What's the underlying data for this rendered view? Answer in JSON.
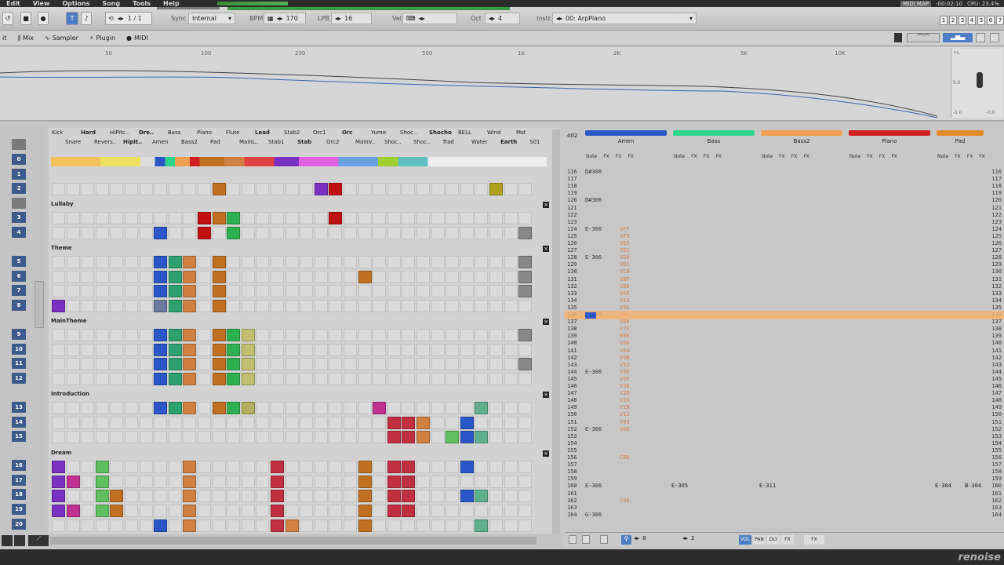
{
  "menu": {
    "items": [
      "Edit",
      "View",
      "Options",
      "Song",
      "Tools",
      "Help"
    ],
    "midi_map": "MIDI MAP",
    "time": "-00:02:10",
    "cpu": "CPU: 23.4%"
  },
  "toolbar": {
    "pos": "1 / 1",
    "sync_label": "Sync",
    "sync_value": "Internal",
    "bpm_label": "BPM",
    "bpm_value": "170",
    "lpb_label": "LPB",
    "lpb_value": "16",
    "vel_label": "Vel",
    "oct_label": "Oct",
    "oct_value": "4",
    "instr_label": "Instr.",
    "instr_value": "00: ArpPiano",
    "tracks": [
      "1",
      "2",
      "3",
      "4",
      "5",
      "6",
      "7"
    ]
  },
  "toolbar2": {
    "mix": "Mix",
    "sampler": "Sampler",
    "plugin": "Plugin",
    "midi": "MIDI"
  },
  "spectrum": {
    "freqs": [
      "50",
      "100",
      "200",
      "500",
      "1K",
      "2K",
      "5K",
      "10K"
    ],
    "db_top": "+L",
    "db_mid": "0.0",
    "db_bot": "-1.0",
    "db_bot2": "-0.0"
  },
  "matrix": {
    "tracks_top": [
      "Kick",
      "Hard",
      "HiPitc..",
      "Dre..",
      "Bass",
      "Piano",
      "Flute",
      "Lead",
      "Stab2",
      "Orc1",
      "Orc",
      "Yume",
      "Shoc..",
      "Shocho",
      "BELL",
      "Wind",
      "Mst"
    ],
    "tracks_bot": [
      "Snare",
      "Revers..",
      "Hipit..",
      "Amen",
      "Bass2",
      "Pad",
      "MainL..",
      "Stab1",
      "Stab",
      "Orc2",
      "MainV..",
      "Shoc..",
      "Shoc..",
      "Trad",
      "Water",
      "Earth",
      "S01"
    ],
    "sections": [
      "Lullaby",
      "Theme",
      "MainTheme",
      "Introduction",
      "Dream"
    ],
    "rows": [
      "0",
      "1",
      "2",
      "3",
      "4",
      "5",
      "6",
      "7",
      "8",
      "9",
      "10",
      "11",
      "12",
      "13",
      "14",
      "15",
      "16",
      "17",
      "18",
      "19",
      "20"
    ],
    "play_label": "PLAY"
  },
  "pattern": {
    "top_num": "402",
    "columns": [
      {
        "name": "Amen",
        "color": "#2b56c7"
      },
      {
        "name": "Bass",
        "color": "#2fd58f"
      },
      {
        "name": "Bass2",
        "color": "#f0a050"
      },
      {
        "name": "Piano",
        "color": "#d02020"
      },
      {
        "name": "Pad",
        "color": "#e08a2a"
      }
    ],
    "col_sub": [
      "Note",
      "FX",
      "FX",
      "FX"
    ],
    "lines": [
      {
        "n": "116",
        "note": "D#306",
        "fx": ""
      },
      {
        "n": "117",
        "note": "",
        "fx": ""
      },
      {
        "n": "118",
        "note": "",
        "fx": ""
      },
      {
        "n": "119",
        "note": "",
        "fx": ""
      },
      {
        "n": "120",
        "note": "D#306",
        "fx": ""
      },
      {
        "n": "121",
        "note": "",
        "fx": ""
      },
      {
        "n": "122",
        "note": "",
        "fx": ""
      },
      {
        "n": "123",
        "note": "",
        "fx": ""
      },
      {
        "n": "124",
        "note": "E-306",
        "fx": "VFF"
      },
      {
        "n": "125",
        "note": "",
        "fx": "VF5"
      },
      {
        "n": "126",
        "note": "",
        "fx": "VE5"
      },
      {
        "n": "127",
        "note": "",
        "fx": "VE1"
      },
      {
        "n": "128",
        "note": "E-306",
        "fx": "VDA"
      },
      {
        "n": "129",
        "note": "",
        "fx": "VD1"
      },
      {
        "n": "130",
        "note": "",
        "fx": "VC8"
      },
      {
        "n": "131",
        "note": "",
        "fx": "VBF"
      },
      {
        "n": "132",
        "note": "",
        "fx": "VB6"
      },
      {
        "n": "133",
        "note": "",
        "fx": "VA5"
      },
      {
        "n": "134",
        "note": "",
        "fx": "VA3"
      },
      {
        "n": "135",
        "note": "",
        "fx": "V9A"
      },
      {
        "n": "136",
        "note": "D#306",
        "fx": "V91"
      },
      {
        "n": "137",
        "note": "",
        "fx": "V88"
      },
      {
        "n": "138",
        "note": "",
        "fx": "V7F"
      },
      {
        "n": "139",
        "note": "",
        "fx": "B00"
      },
      {
        "n": "140",
        "note": "",
        "fx": "V6D"
      },
      {
        "n": "141",
        "note": "",
        "fx": "V64"
      },
      {
        "n": "142",
        "note": "",
        "fx": "V5B"
      },
      {
        "n": "143",
        "note": "",
        "fx": "V52"
      },
      {
        "n": "144",
        "note": "E-306",
        "fx": "V48"
      },
      {
        "n": "145",
        "note": "",
        "fx": "V3F"
      },
      {
        "n": "146",
        "note": "",
        "fx": "V36"
      },
      {
        "n": "147",
        "note": "",
        "fx": "V2D"
      },
      {
        "n": "148",
        "note": "",
        "fx": "V24"
      },
      {
        "n": "149",
        "note": "",
        "fx": "V1B"
      },
      {
        "n": "150",
        "note": "",
        "fx": "V12"
      },
      {
        "n": "151",
        "note": "",
        "fx": "V09"
      },
      {
        "n": "152",
        "note": "E-306",
        "fx": "V00"
      },
      {
        "n": "153",
        "note": "",
        "fx": ""
      },
      {
        "n": "154",
        "note": "",
        "fx": ""
      },
      {
        "n": "155",
        "note": "",
        "fx": ""
      },
      {
        "n": "156",
        "note": "",
        "fx": "C00"
      },
      {
        "n": "157",
        "note": "",
        "fx": ""
      },
      {
        "n": "158",
        "note": "",
        "fx": ""
      },
      {
        "n": "159",
        "note": "",
        "fx": ""
      },
      {
        "n": "160",
        "note": "E-306",
        "fx": ""
      },
      {
        "n": "161",
        "note": "",
        "fx": ""
      },
      {
        "n": "162",
        "note": "",
        "fx": "C00"
      },
      {
        "n": "163",
        "note": "",
        "fx": ""
      },
      {
        "n": "164",
        "note": "G-306",
        "fx": ""
      }
    ],
    "col2_160": "E-305",
    "col3_160": "E-311",
    "col5_160": "E-304",
    "col5b_160": "B-304"
  },
  "bottom": {
    "step": "8",
    "oct": "2",
    "vol": "VOL",
    "pan": "PAN",
    "dly": "DLY",
    "fx": "FX",
    "fx2": "FX"
  },
  "brand": "renoise"
}
